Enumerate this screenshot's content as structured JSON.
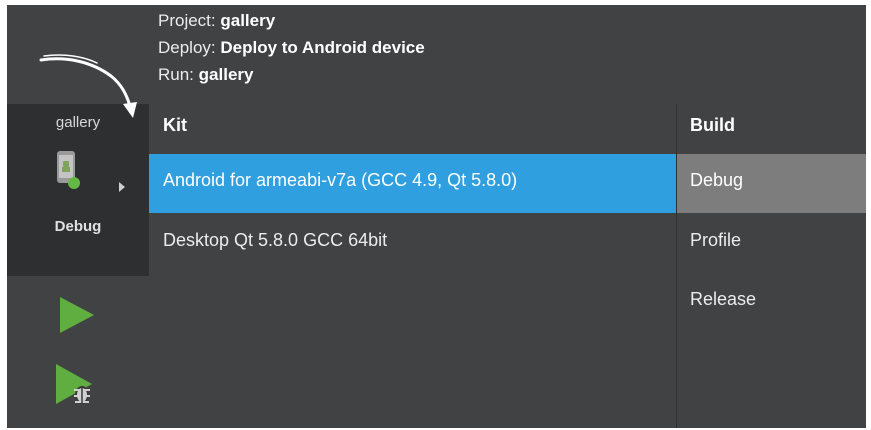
{
  "header": {
    "project_label": "Project:",
    "project_value": "gallery",
    "deploy_label": "Deploy:",
    "deploy_value": "Deploy to Android device",
    "run_label": "Run:",
    "run_value": "gallery"
  },
  "sidebar": {
    "project_name": "gallery",
    "build_config": "Debug",
    "device_icon": "android-device-icon",
    "run_icon": "run-icon",
    "debug_icon": "debug-run-icon"
  },
  "kits": {
    "column_header": "Kit",
    "items": [
      {
        "label": "Android for armeabi-v7a (GCC 4.9, Qt 5.8.0)"
      },
      {
        "label": "Desktop Qt 5.8.0 GCC 64bit"
      }
    ],
    "selected_index": 0
  },
  "builds": {
    "column_header": "Build",
    "items": [
      {
        "label": "Debug"
      },
      {
        "label": "Profile"
      },
      {
        "label": "Release"
      }
    ],
    "selected_index": 0
  },
  "colors": {
    "background": "#404244",
    "selection": "#2f9fe0",
    "build_selection": "#7d7d7d",
    "run_green": "#5fae3f"
  }
}
